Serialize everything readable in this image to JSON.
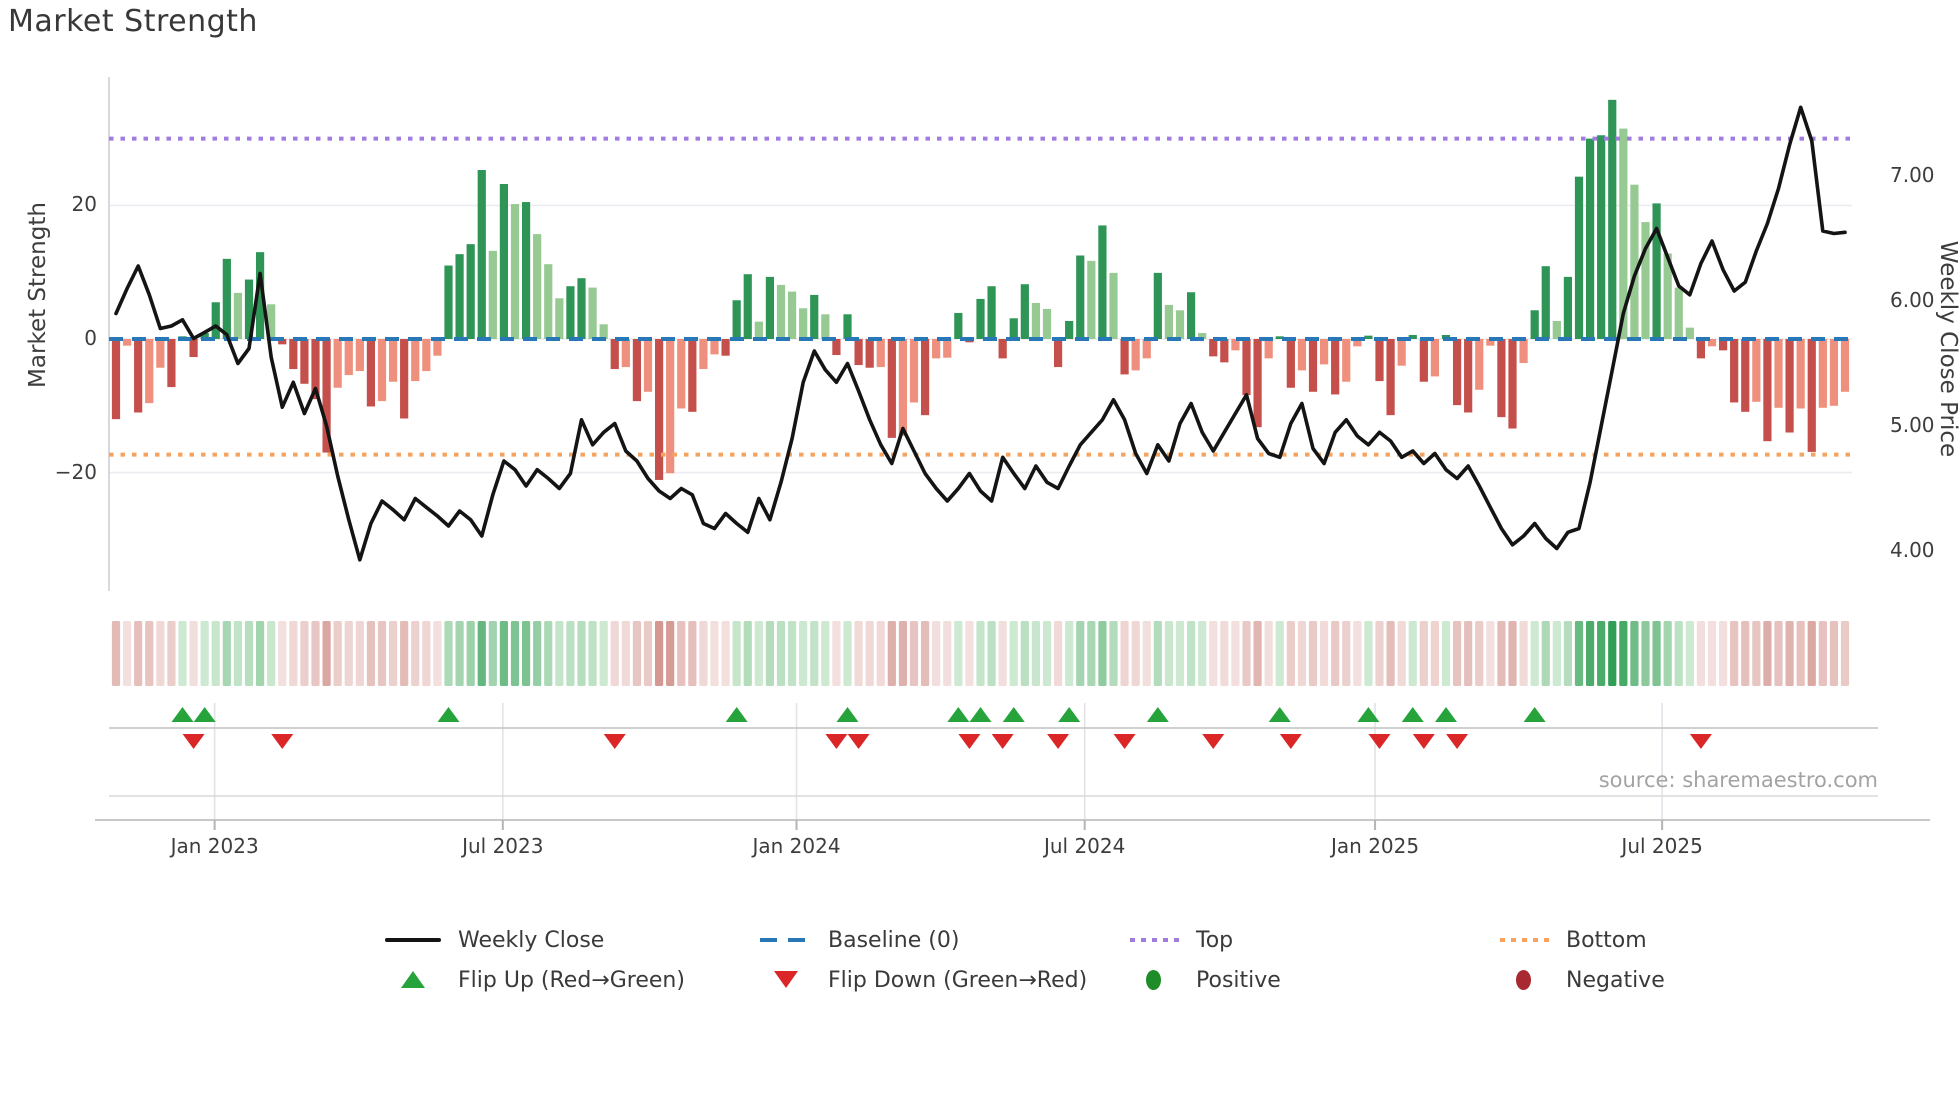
{
  "title": "Market Strength",
  "axes": {
    "strength": {
      "label": "Market Strength",
      "ticks": [
        "20",
        "0",
        "−20"
      ],
      "tick_values": [
        20,
        0,
        -20
      ]
    },
    "price": {
      "label": "Weekly Close Price",
      "ticks": [
        "7.00",
        "6.00",
        "5.00",
        "4.00"
      ],
      "tick_values": [
        7,
        6,
        5,
        4
      ]
    },
    "x": {
      "tick_labels": [
        "Jan 2023",
        "Jul 2023",
        "Jan 2024",
        "Jul 2024",
        "Jan 2025",
        "Jul 2025"
      ],
      "tick_weeks": [
        8.9,
        34.9,
        61.4,
        87.4,
        113.6,
        139.5
      ]
    }
  },
  "source": "source: sharemaestro.com",
  "legend": {
    "weekly_close": "Weekly Close",
    "baseline": "Baseline (0)",
    "top": "Top",
    "bottom": "Bottom",
    "flip_up": "Flip Up (Red→Green)",
    "flip_down": "Flip Down (Green→Red)",
    "positive": "Positive",
    "negative": "Negative"
  },
  "colors": {
    "bar_green_dark": "#2e9556",
    "bar_green_light": "#96ca92",
    "bar_red_dark": "#c44f4b",
    "bar_red_salmon": "#ee907d",
    "baseline_blue": "#2878b8",
    "top_purple": "#a07be0",
    "bottom_orange": "#f5a35f",
    "price_line": "#141414",
    "flip_up_green": "#26a43b",
    "flip_down_red": "#da2626",
    "positive_dot": "#1e8c28",
    "negative_dot": "#a8292f",
    "heat_green_max": "#2f9e53",
    "heat_green_min": "#e3f3e2",
    "heat_red_max": "#d2948d",
    "heat_red_min": "#f7e9e8",
    "grid": "#ececf1",
    "source_text": "#a3a3a3"
  },
  "chart_data": {
    "type": "bar",
    "subtype": "weekly market-strength bars + weekly close price line + momentum heatmap strip + flip markers",
    "title": "Market Strength",
    "xlabel": "",
    "ylabel_left": "Market Strength",
    "ylabel_right": "Weekly Close Price",
    "weeks": 157,
    "x_range_note": "weekly data from ~Nov 2022 to ~Oct 2025",
    "baseline": 0,
    "top_line": 30,
    "bottom_line": -17.3,
    "strength_ylim": [
      -38,
      39
    ],
    "price_ylim": [
      3.68,
      7.79
    ],
    "series": {
      "strength": [
        -12,
        -1,
        -11,
        -9.6,
        -4.3,
        -7.2,
        0.4,
        -2.7,
        0.9,
        5.5,
        12,
        6.9,
        8.9,
        13,
        5.2,
        -0.8,
        -4.5,
        -6.7,
        -9,
        -17,
        -7.3,
        -5.4,
        -4.8,
        -10.1,
        -9.3,
        -6.4,
        -11.9,
        -6.3,
        -4.8,
        -2.5,
        11,
        12.7,
        14.2,
        25.3,
        13.2,
        23.2,
        20.2,
        20.5,
        15.7,
        11.2,
        6.1,
        7.9,
        9.1,
        7.7,
        2.2,
        -4.5,
        -4.2,
        -9.3,
        -7.9,
        -21.1,
        -20.1,
        -10.4,
        -10.9,
        -4.5,
        -2.3,
        -2.5,
        5.8,
        9.7,
        2.6,
        9.3,
        8.1,
        7.1,
        4.6,
        6.6,
        3.7,
        -2.4,
        3.7,
        -3.9,
        -4.3,
        -4.2,
        -14.8,
        -14.5,
        -9.5,
        -11.4,
        -2.9,
        -2.8,
        3.9,
        -0.5,
        6,
        7.9,
        -2.9,
        3.1,
        8.2,
        5.4,
        4.5,
        -4.2,
        2.7,
        12.5,
        11.7,
        17,
        9.9,
        -5.3,
        -4.7,
        -2.9,
        9.9,
        5.1,
        4.3,
        7,
        0.9,
        -2.6,
        -3.5,
        -1.7,
        -8.4,
        -13.2,
        -2.9,
        0.4,
        -7.3,
        -4.7,
        -7.9,
        -3.8,
        -8.3,
        -6.4,
        -1.1,
        0.5,
        -6.3,
        -11.4,
        -4,
        0.6,
        -6.4,
        -5.6,
        0.6,
        -9.9,
        -11,
        -7.6,
        -1,
        -11.7,
        -13.4,
        -3.6,
        4.3,
        10.9,
        2.7,
        9.3,
        24.3,
        30,
        30.5,
        35.8,
        31.5,
        23.1,
        17.5,
        20.3,
        12.8,
        7.7,
        1.7,
        -2.9,
        -1.1,
        -1.7,
        -9.5,
        -10.9,
        -9.4,
        -15.3,
        -10.3,
        -14,
        -10.4,
        -16.9,
        -10.3,
        -10,
        -7.9
      ],
      "price": [
        5.9,
        6.1,
        6.28,
        6.05,
        5.78,
        5.8,
        5.85,
        5.7,
        5.75,
        5.8,
        5.73,
        5.5,
        5.62,
        6.22,
        5.55,
        5.15,
        5.35,
        5.1,
        5.3,
        5.0,
        4.6,
        4.25,
        3.93,
        4.22,
        4.4,
        4.33,
        4.25,
        4.42,
        4.35,
        4.28,
        4.2,
        4.32,
        4.25,
        4.12,
        4.45,
        4.72,
        4.65,
        4.52,
        4.65,
        4.58,
        4.5,
        4.62,
        5.05,
        4.85,
        4.95,
        5.02,
        4.8,
        4.72,
        4.58,
        4.48,
        4.42,
        4.5,
        4.45,
        4.22,
        4.18,
        4.3,
        4.22,
        4.15,
        4.42,
        4.25,
        4.55,
        4.9,
        5.35,
        5.6,
        5.45,
        5.35,
        5.5,
        5.28,
        5.05,
        4.85,
        4.7,
        4.98,
        4.8,
        4.62,
        4.5,
        4.4,
        4.5,
        4.62,
        4.48,
        4.4,
        4.75,
        4.62,
        4.5,
        4.68,
        4.55,
        4.5,
        4.68,
        4.85,
        4.95,
        5.05,
        5.21,
        5.05,
        4.78,
        4.62,
        4.85,
        4.72,
        5.02,
        5.18,
        4.95,
        4.8,
        4.95,
        5.1,
        5.25,
        4.9,
        4.78,
        4.75,
        5.02,
        5.18,
        4.82,
        4.7,
        4.95,
        5.05,
        4.92,
        4.85,
        4.95,
        4.88,
        4.75,
        4.8,
        4.7,
        4.78,
        4.65,
        4.58,
        4.68,
        4.52,
        4.35,
        4.18,
        4.05,
        4.12,
        4.22,
        4.1,
        4.02,
        4.15,
        4.18,
        4.55,
        5.0,
        5.45,
        5.9,
        6.2,
        6.42,
        6.58,
        6.35,
        6.12,
        6.05,
        6.3,
        6.48,
        6.25,
        6.08,
        6.15,
        6.4,
        6.62,
        6.9,
        7.25,
        7.55,
        7.28,
        6.56,
        6.54,
        6.55
      ]
    },
    "flip_up_weeks": [
      6,
      8,
      30,
      56,
      66,
      76,
      78,
      81,
      86,
      94,
      105,
      113,
      117,
      120,
      128
    ],
    "flip_down_weeks": [
      7,
      15,
      45,
      65,
      67,
      77,
      80,
      85,
      91,
      99,
      106,
      114,
      118,
      121,
      143
    ],
    "bar_shade_rule": "dark green when positive and >= previous, light green otherwise; dark red when negative and <= previous, salmon otherwise",
    "heatmap": "one cell per week, diverging red-green color keyed to strength value",
    "legend_position": "bottom, two rows",
    "grid": "horizontal gridlines at strength 20 / 0 / -20"
  }
}
